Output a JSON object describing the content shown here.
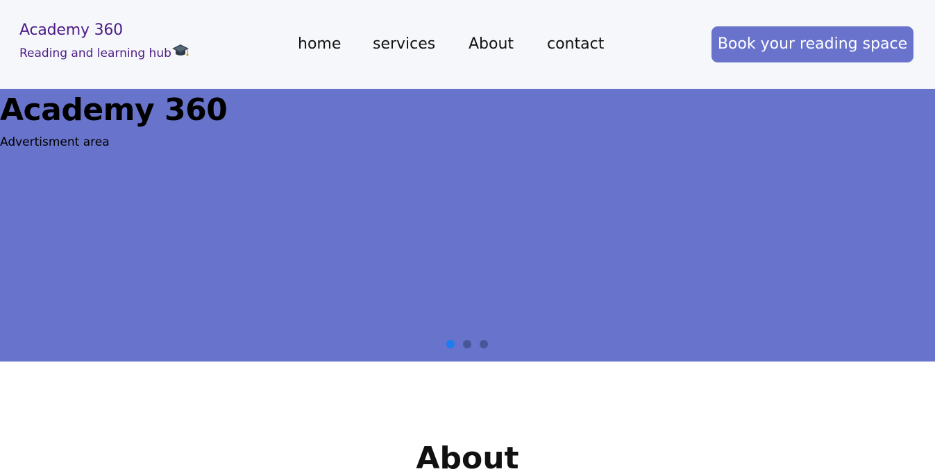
{
  "brand": {
    "title": "Academy 360",
    "subtitle": "Reading and learning hub",
    "icon": "graduation-cap-icon"
  },
  "nav": {
    "items": [
      {
        "label": "home"
      },
      {
        "label": "services"
      },
      {
        "label": "About"
      },
      {
        "label": "contact"
      }
    ]
  },
  "cta": {
    "label": "Book your reading space"
  },
  "hero": {
    "title": "Academy 360",
    "subtitle": "Advertisment area",
    "slides": 3,
    "active_slide": 1
  },
  "about": {
    "heading": "About"
  },
  "colors": {
    "navbar_bg": "#f6f7fa",
    "brand": "#4b1c87",
    "accent": "#6a73cc",
    "hero_bg": "#6873cb",
    "active_dot": "#1e7cf2",
    "inactive_dot": "#4a5599"
  }
}
